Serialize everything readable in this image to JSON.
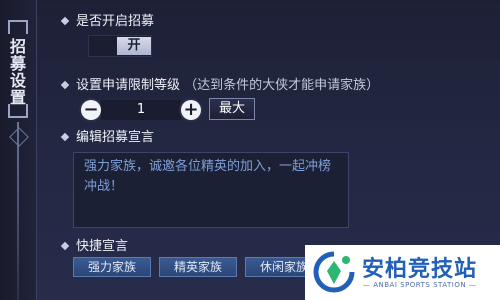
{
  "sidebar": {
    "title_chars": [
      "招",
      "募",
      "设",
      "置"
    ]
  },
  "recruit_toggle": {
    "label": "是否开启招募",
    "state_label": "开"
  },
  "level_limit": {
    "label": "设置申请限制等级",
    "hint": "（达到条件的大侠才能申请家族）",
    "value": "1",
    "minus_symbol": "−",
    "plus_symbol": "+",
    "max_label": "最大"
  },
  "declaration": {
    "label": "编辑招募宣言",
    "text": "强力家族，诚邀各位精英的加入，一起冲榜冲战！"
  },
  "quick": {
    "label": "快捷宣言",
    "buttons": [
      "强力家族",
      "精英家族",
      "休闲家族"
    ]
  },
  "watermark": {
    "title": "安柏竞技站",
    "subtitle": "— ANBAI SPORTS STATION —"
  },
  "colors": {
    "accent_blue": "#2c4676",
    "text_hint": "#7e9ed8",
    "watermark_blue": "#2160b8"
  }
}
